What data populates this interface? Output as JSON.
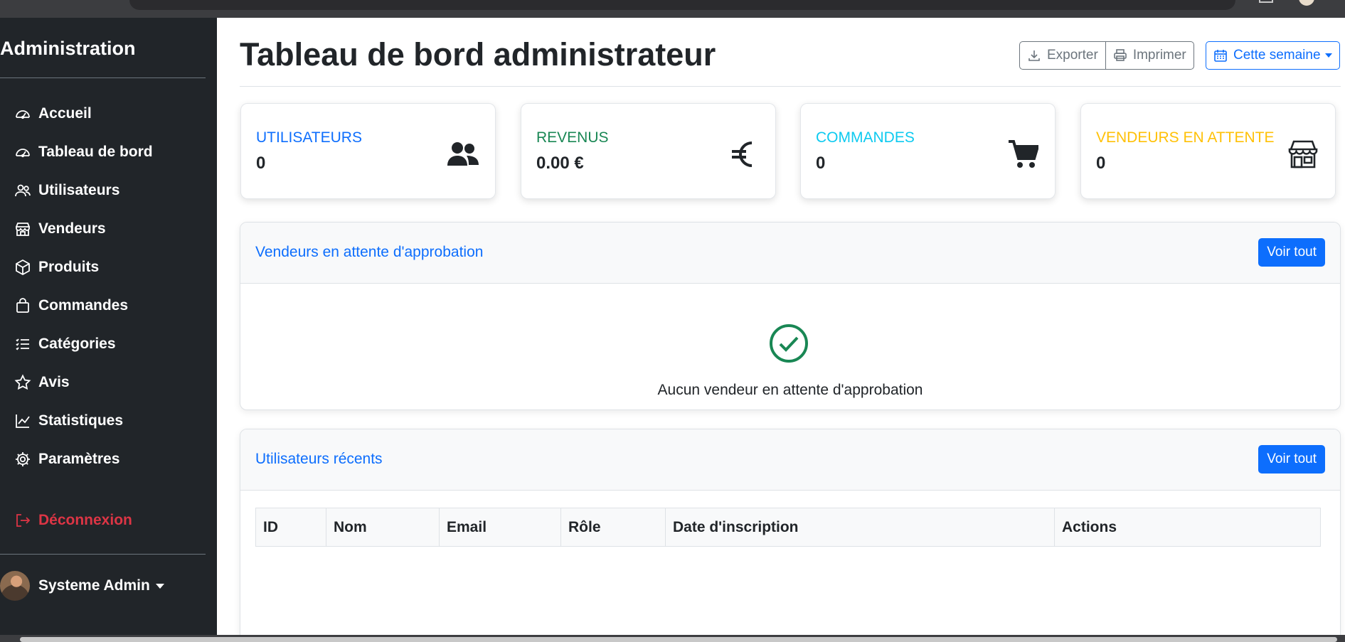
{
  "sidebar": {
    "brand": "Administration",
    "items": [
      {
        "label": "Accueil"
      },
      {
        "label": "Tableau de bord"
      },
      {
        "label": "Utilisateurs"
      },
      {
        "label": "Vendeurs"
      },
      {
        "label": "Produits"
      },
      {
        "label": "Commandes"
      },
      {
        "label": "Catégories"
      },
      {
        "label": "Avis"
      },
      {
        "label": "Statistiques"
      },
      {
        "label": "Paramètres"
      }
    ],
    "logout": "Déconnexion",
    "user_name": "Systeme Admin"
  },
  "header": {
    "title": "Tableau de bord administrateur",
    "export_label": "Exporter",
    "print_label": "Imprimer",
    "period_label": "Cette semaine"
  },
  "stats": [
    {
      "label": "UTILISATEURS",
      "value": "0",
      "color": "#0d6efd",
      "icon": "users-icon"
    },
    {
      "label": "REVENUS",
      "value": "0.00 €",
      "color": "#198754",
      "icon": "euro-icon"
    },
    {
      "label": "COMMANDES",
      "value": "0",
      "color": "#0dcaf0",
      "icon": "cart-icon"
    },
    {
      "label": "VENDEURS EN ATTENTE",
      "value": "0",
      "color": "#ffc107",
      "icon": "store-icon"
    }
  ],
  "pending_panel": {
    "title": "Vendeurs en attente d'approbation",
    "button": "Voir tout",
    "empty_text": "Aucun vendeur en attente d'approbation"
  },
  "recent_users_panel": {
    "title": "Utilisateurs récents",
    "button": "Voir tout",
    "columns": [
      "ID",
      "Nom",
      "Email",
      "Rôle",
      "Date d'inscription",
      "Actions"
    ]
  },
  "colors": {
    "sidebar_bg": "#212529",
    "primary": "#0d6efd",
    "danger": "#dc3545",
    "success": "#198754"
  }
}
